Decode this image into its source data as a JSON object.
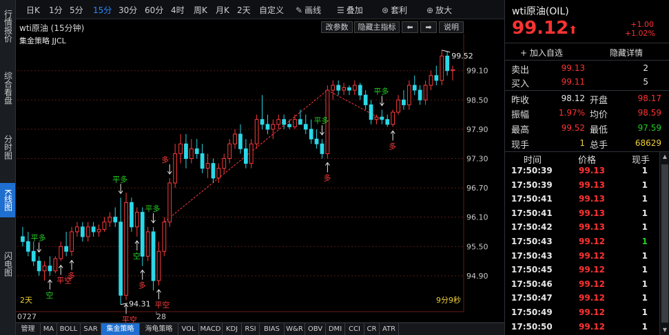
{
  "left_nav": [
    {
      "label": "行情报价",
      "active": false
    },
    {
      "label": "综合看盘",
      "active": false
    },
    {
      "label": "分时图",
      "active": false
    },
    {
      "label": "K线图",
      "active": true
    },
    {
      "label": "闪电图",
      "active": false
    }
  ],
  "toolbar": {
    "periods": [
      "日K",
      "1分",
      "5分",
      "15分",
      "30分",
      "60分",
      "4时",
      "周K",
      "月K",
      "2天",
      "自定义"
    ],
    "active_period": "15分",
    "draw_label": "画线",
    "overlay_label": "叠加",
    "arbitrage_label": "套利",
    "zoom_label": "放大",
    "close_label": "✕"
  },
  "chart_header": {
    "title": "wti原油 (15分钟)",
    "buttons": {
      "params": "改参数",
      "hide_main": "隐藏主指标",
      "prev": "⬅",
      "next": "➡",
      "help": "说明"
    },
    "strategy": "集金策略 JJCL"
  },
  "chart_data": {
    "type": "candlestick",
    "y_ticks": [
      94.9,
      95.5,
      96.1,
      96.7,
      97.3,
      97.9,
      98.5,
      99.1
    ],
    "ylim": [
      94.25,
      99.8
    ],
    "x_labels": [
      "0727",
      "28"
    ],
    "period_label": "2天",
    "countdown": "9分9秒",
    "annotation_high": "99.52",
    "annotation_low": "94.31",
    "colors": {
      "up": "#ff3c3c",
      "down": "#2bd8e8",
      "grid": "#5a1a1a",
      "axis": "#8a8a8a"
    },
    "candles": [
      [
        95.7,
        95.9,
        95.5,
        95.6
      ],
      [
        95.6,
        95.8,
        95.3,
        95.4
      ],
      [
        95.4,
        95.6,
        95.1,
        95.2
      ],
      [
        95.2,
        95.3,
        94.9,
        95.0
      ],
      [
        95.0,
        95.2,
        94.8,
        95.1
      ],
      [
        95.1,
        95.3,
        94.9,
        95.0
      ],
      [
        95.0,
        95.3,
        94.95,
        95.25
      ],
      [
        95.25,
        95.6,
        95.2,
        95.5
      ],
      [
        95.5,
        95.8,
        95.3,
        95.4
      ],
      [
        95.4,
        95.9,
        95.3,
        95.8
      ],
      [
        95.8,
        96.0,
        95.7,
        95.9
      ],
      [
        95.9,
        96.0,
        95.6,
        95.7
      ],
      [
        95.7,
        96.0,
        95.6,
        95.9
      ],
      [
        95.9,
        96.0,
        95.7,
        95.8
      ],
      [
        95.8,
        95.95,
        95.7,
        95.85
      ],
      [
        95.85,
        96.1,
        95.8,
        96.0
      ],
      [
        96.0,
        96.2,
        95.9,
        96.1
      ],
      [
        96.1,
        96.3,
        95.9,
        96.0
      ],
      [
        96.0,
        96.5,
        94.31,
        94.5
      ],
      [
        94.5,
        96.6,
        94.4,
        96.4
      ],
      [
        96.4,
        96.5,
        95.8,
        95.9
      ],
      [
        95.9,
        96.3,
        95.7,
        96.2
      ],
      [
        96.2,
        96.3,
        95.1,
        95.3
      ],
      [
        95.3,
        95.9,
        95.2,
        95.8
      ],
      [
        95.8,
        95.9,
        94.6,
        94.8
      ],
      [
        94.8,
        95.6,
        94.7,
        95.4
      ],
      [
        95.4,
        96.1,
        95.3,
        96.0
      ],
      [
        96.0,
        96.9,
        95.9,
        96.8
      ],
      [
        96.8,
        97.6,
        96.7,
        97.4
      ],
      [
        97.4,
        97.8,
        97.2,
        97.6
      ],
      [
        97.6,
        97.8,
        97.1,
        97.3
      ],
      [
        97.3,
        97.7,
        97.2,
        97.5
      ],
      [
        97.5,
        97.7,
        97.3,
        97.4
      ],
      [
        97.4,
        97.6,
        97.0,
        97.1
      ],
      [
        97.1,
        97.4,
        96.9,
        97.2
      ],
      [
        97.2,
        97.3,
        96.8,
        96.9
      ],
      [
        96.9,
        97.2,
        96.8,
        97.1
      ],
      [
        97.1,
        97.4,
        97.0,
        97.3
      ],
      [
        97.3,
        97.7,
        97.2,
        97.6
      ],
      [
        97.6,
        97.9,
        97.5,
        97.8
      ],
      [
        97.8,
        98.0,
        97.4,
        97.5
      ],
      [
        97.5,
        97.7,
        97.1,
        97.2
      ],
      [
        97.2,
        97.7,
        97.1,
        97.6
      ],
      [
        97.6,
        98.2,
        97.5,
        98.1
      ],
      [
        98.1,
        98.6,
        97.9,
        98.0
      ],
      [
        98.0,
        98.2,
        97.8,
        97.9
      ],
      [
        97.9,
        98.1,
        97.7,
        98.0
      ],
      [
        98.0,
        98.2,
        97.9,
        98.1
      ],
      [
        98.1,
        98.2,
        97.9,
        98.0
      ],
      [
        98.0,
        98.1,
        97.9,
        97.95
      ],
      [
        97.95,
        98.2,
        97.9,
        98.1
      ],
      [
        98.1,
        98.3,
        98.0,
        98.0
      ],
      [
        98.0,
        98.2,
        97.8,
        97.9
      ],
      [
        97.9,
        98.1,
        97.6,
        97.7
      ],
      [
        97.7,
        97.9,
        97.5,
        97.6
      ],
      [
        97.6,
        97.7,
        97.3,
        97.4
      ],
      [
        97.4,
        98.8,
        97.3,
        98.7
      ],
      [
        98.7,
        98.9,
        98.5,
        98.8
      ],
      [
        98.8,
        98.9,
        98.6,
        98.7
      ],
      [
        98.7,
        98.85,
        98.6,
        98.75
      ],
      [
        98.75,
        98.8,
        98.6,
        98.7
      ],
      [
        98.7,
        98.9,
        98.6,
        98.8
      ],
      [
        98.8,
        98.85,
        98.5,
        98.6
      ],
      [
        98.6,
        98.7,
        98.3,
        98.4
      ],
      [
        98.4,
        98.5,
        98.0,
        98.1
      ],
      [
        98.1,
        98.2,
        98.0,
        98.15
      ],
      [
        98.15,
        98.3,
        98.0,
        98.1
      ],
      [
        98.1,
        98.2,
        97.95,
        98.0
      ],
      [
        98.0,
        98.3,
        97.95,
        98.25
      ],
      [
        98.25,
        98.6,
        98.2,
        98.5
      ],
      [
        98.5,
        98.7,
        98.3,
        98.4
      ],
      [
        98.4,
        98.9,
        98.3,
        98.8
      ],
      [
        98.8,
        99.0,
        98.6,
        98.7
      ],
      [
        98.7,
        98.8,
        98.4,
        98.5
      ],
      [
        98.5,
        98.9,
        98.4,
        98.8
      ],
      [
        98.8,
        99.1,
        98.7,
        99.0
      ],
      [
        99.0,
        99.2,
        98.8,
        98.9
      ],
      [
        98.9,
        99.52,
        98.8,
        99.4
      ],
      [
        99.4,
        99.5,
        99.0,
        99.1
      ],
      [
        99.1,
        99.2,
        98.9,
        99.12
      ]
    ],
    "signals": [
      {
        "i": 3,
        "text": "平多",
        "color": "green",
        "pos": "above"
      },
      {
        "i": 5,
        "text": "空",
        "color": "green",
        "pos": "below"
      },
      {
        "i": 7,
        "text": "平空",
        "color": "red",
        "pos": "below"
      },
      {
        "i": 9,
        "text": "多",
        "color": "red",
        "pos": "below"
      },
      {
        "i": 18,
        "text": "平多",
        "color": "green",
        "pos": "above"
      },
      {
        "i": 19,
        "text": "平空",
        "color": "red",
        "pos": "below"
      },
      {
        "i": 21,
        "text": "空",
        "color": "green",
        "pos": "below"
      },
      {
        "i": 22,
        "text": "多",
        "color": "red",
        "pos": "below"
      },
      {
        "i": 24,
        "text": "平多",
        "color": "green",
        "pos": "above"
      },
      {
        "i": 25,
        "text": "平空",
        "color": "red",
        "pos": "below"
      },
      {
        "i": 27,
        "text": "多",
        "color": "red",
        "pos": "above"
      },
      {
        "i": 55,
        "text": "平多",
        "color": "green",
        "pos": "above"
      },
      {
        "i": 56,
        "text": "多",
        "color": "red",
        "pos": "below"
      },
      {
        "i": 66,
        "text": "平多",
        "color": "green",
        "pos": "above"
      },
      {
        "i": 68,
        "text": "多",
        "color": "red",
        "pos": "below"
      }
    ],
    "dashed_links": [
      [
        26,
        56
      ],
      [
        56,
        66
      ]
    ]
  },
  "bottom_tabs": [
    "管理",
    "MA",
    "BOLL",
    "SAR",
    "集金策略",
    "海龟策略",
    "VOL",
    "MACD",
    "KDJ",
    "RSI",
    "BIAS",
    "W&R",
    "OBV",
    "DMI",
    "CCI",
    "CR",
    "ATR"
  ],
  "active_bottom_tab": "集金策略",
  "quote": {
    "title": "wti原油(OIL)",
    "price": "99.12",
    "arrow": "⬆",
    "change": "+1.00",
    "change_pct": "+1.02%",
    "add_watch": "+ 加入自选",
    "hide_detail": "隐藏详情",
    "sell_label": "卖出",
    "sell_price": "99.13",
    "sell_vol": "2",
    "buy_label": "买入",
    "buy_price": "99.11",
    "buy_vol": "5",
    "prev_close_label": "昨收",
    "prev_close": "98.12",
    "open_label": "开盘",
    "open": "98.17",
    "amplitude_label": "振幅",
    "amplitude": "1.97%",
    "avg_label": "均价",
    "avg": "98.59",
    "high_label": "最高",
    "high": "99.52",
    "low_label": "最低",
    "low": "97.59",
    "current_vol_label": "现手",
    "current_vol": "1",
    "total_vol_label": "总手",
    "total_vol": "68629"
  },
  "trades": {
    "headers": [
      "时间",
      "价格",
      "现手"
    ],
    "rows": [
      {
        "time": "17:50:39",
        "price": "99.13",
        "vol": "1",
        "vol_color": "white"
      },
      {
        "time": "17:50:39",
        "price": "99.13",
        "vol": "1",
        "vol_color": "white"
      },
      {
        "time": "17:50:41",
        "price": "99.13",
        "vol": "1",
        "vol_color": "white"
      },
      {
        "time": "17:50:41",
        "price": "99.13",
        "vol": "1",
        "vol_color": "white"
      },
      {
        "time": "17:50:42",
        "price": "99.13",
        "vol": "1",
        "vol_color": "white"
      },
      {
        "time": "17:50:43",
        "price": "99.12",
        "vol": "1",
        "vol_color": "green"
      },
      {
        "time": "17:50:43",
        "price": "99.12",
        "vol": "1",
        "vol_color": "white"
      },
      {
        "time": "17:50:45",
        "price": "99.12",
        "vol": "1",
        "vol_color": "white"
      },
      {
        "time": "17:50:46",
        "price": "99.12",
        "vol": "1",
        "vol_color": "white"
      },
      {
        "time": "17:50:47",
        "price": "99.12",
        "vol": "1",
        "vol_color": "white"
      },
      {
        "time": "17:50:49",
        "price": "99.12",
        "vol": "1",
        "vol_color": "white"
      },
      {
        "time": "17:50:50",
        "price": "99.12",
        "vol": "1",
        "vol_color": "white"
      }
    ]
  }
}
